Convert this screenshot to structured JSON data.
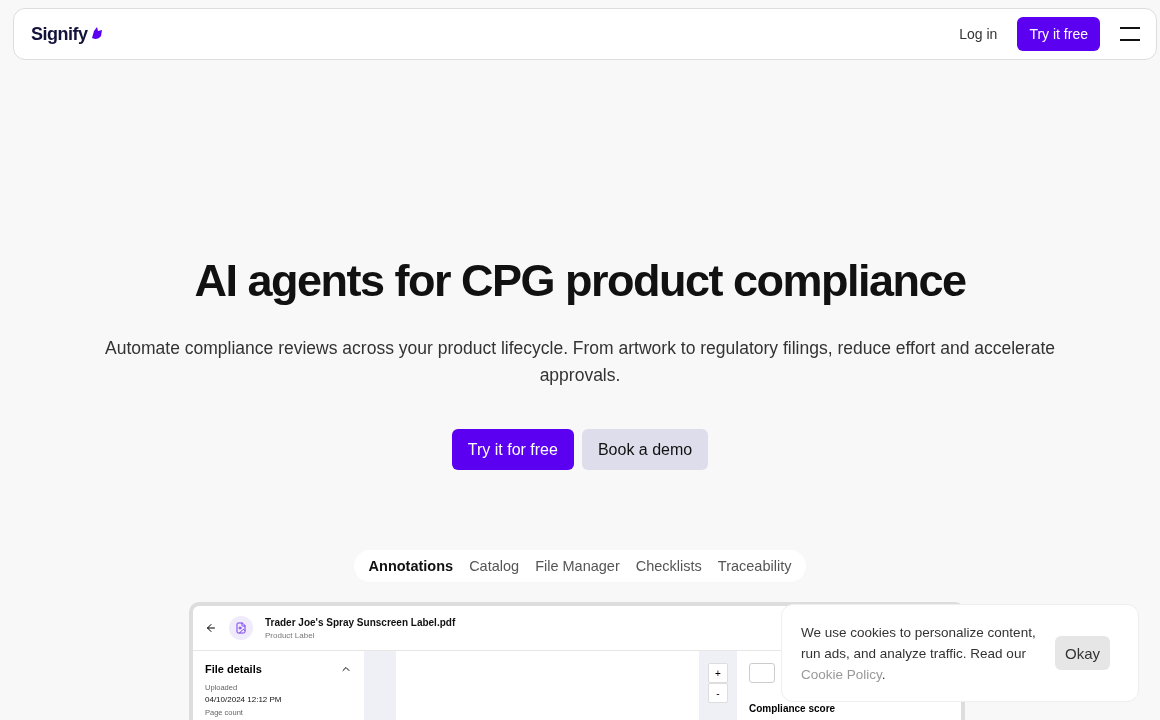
{
  "header": {
    "logo": "Signify",
    "login": "Log in",
    "cta": "Try it free"
  },
  "hero": {
    "title": "AI agents for CPG product compliance",
    "subtitle": "Automate compliance reviews across your product lifecycle. From artwork to regulatory filings, reduce effort and accelerate approvals.",
    "primary": "Try it for free",
    "secondary": "Book a demo"
  },
  "tabs": [
    {
      "label": "Annotations",
      "selected": true
    },
    {
      "label": "Catalog",
      "selected": false
    },
    {
      "label": "File Manager",
      "selected": false
    },
    {
      "label": "Checklists",
      "selected": false
    },
    {
      "label": "Traceability",
      "selected": false
    }
  ],
  "preview": {
    "file_name": "Trader Joe's Spray Sunscreen Label.pdf",
    "file_type": "Product Label",
    "panel_title": "File details",
    "expanded": true,
    "fields": [
      {
        "label": "Uploaded",
        "value": "04/10/2024  12:12 PM"
      },
      {
        "label": "Page count"
      }
    ],
    "zoom_in": "+",
    "zoom_out": "-",
    "score_title": "Compliance score"
  },
  "cookie": {
    "text": "We use cookies to personalize content, run ads, and analyze traffic. Read our",
    "link": "Cookie Policy",
    "end": ".",
    "button": "Okay"
  }
}
